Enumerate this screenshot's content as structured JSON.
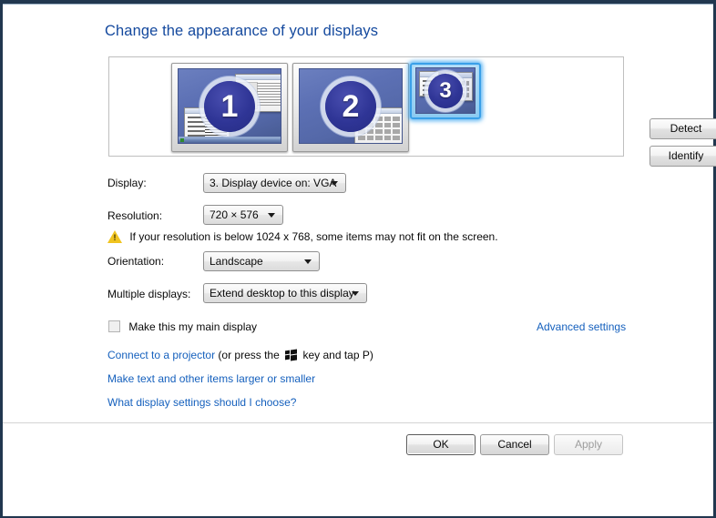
{
  "window": {
    "title": "Change the appearance of your displays"
  },
  "preview": {
    "monitors": [
      {
        "number": "1",
        "selected": false
      },
      {
        "number": "2",
        "selected": false
      },
      {
        "number": "3",
        "selected": true
      }
    ],
    "detect_button": "Detect",
    "identify_button": "Identify"
  },
  "form": {
    "display_label": "Display:",
    "display_value": "3. Display device on: VGA",
    "resolution_label": "Resolution:",
    "resolution_value": "720 × 576",
    "warning_text": "If your resolution is below 1024 x 768, some items may not fit on the screen.",
    "warning_icon": "warning-triangle-icon",
    "orientation_label": "Orientation:",
    "orientation_value": "Landscape",
    "multiple_displays_label": "Multiple displays:",
    "multiple_displays_value": "Extend desktop to this display",
    "main_display_checkbox_label": "Make this my main display",
    "advanced_settings_link": "Advanced settings"
  },
  "links": {
    "projector_link": "Connect to a projector",
    "projector_suffix_before": "(or press the",
    "projector_key_icon": "windows-logo-key-icon",
    "projector_suffix_after": "key and tap P)",
    "text_size_link": "Make text and other items larger or smaller",
    "what_settings_link": "What display settings should I choose?"
  },
  "footer": {
    "ok_button": "OK",
    "cancel_button": "Cancel",
    "apply_button": "Apply",
    "apply_disabled": true
  },
  "colors": {
    "title_blue": "#14499e",
    "link_blue": "#1560bd",
    "frame_navy": "#21374f",
    "selection_blue": "#3aa0e8",
    "warning_yellow": "#f0c420",
    "monitor_screen_blue": "#5c70b4"
  }
}
